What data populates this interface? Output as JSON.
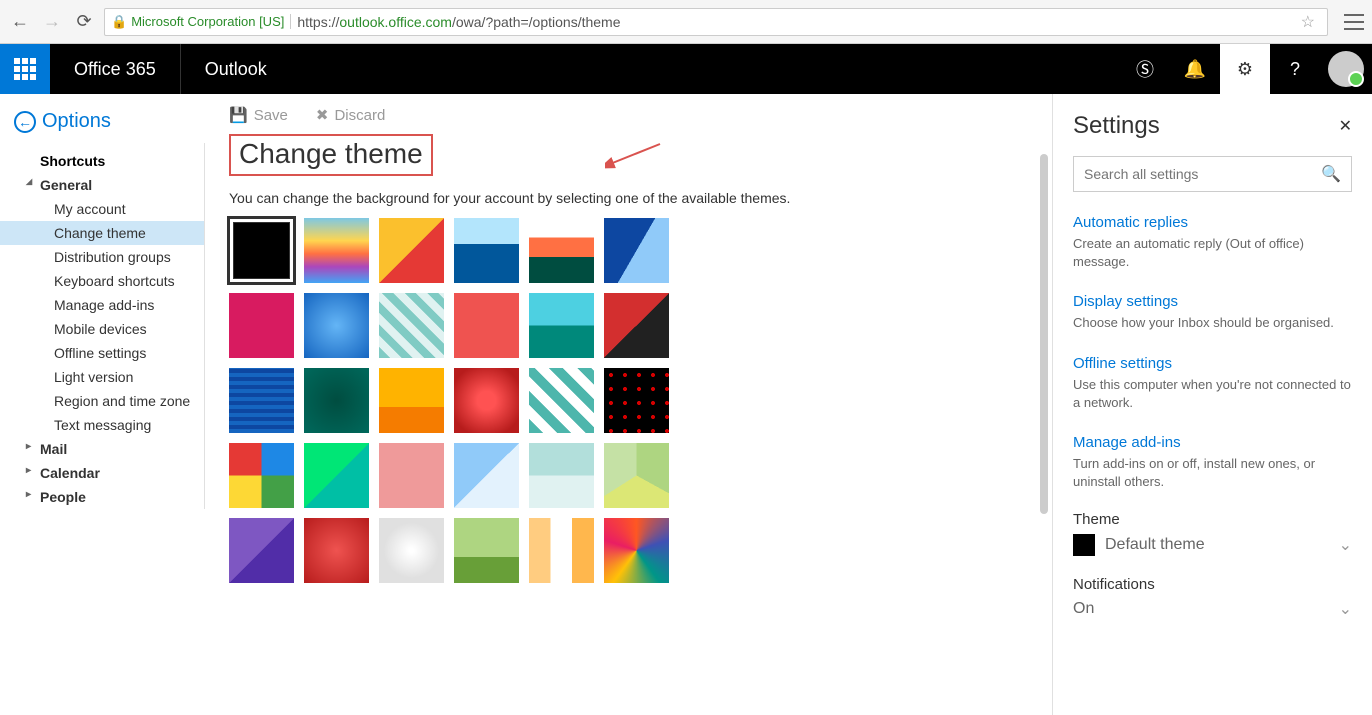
{
  "browser": {
    "verified_org": "Microsoft Corporation [US]",
    "url_domain": "https://",
    "url_host": "outlook.office.com",
    "url_path": "/owa/?path=/options/theme"
  },
  "header": {
    "brand": "Office 365",
    "app": "Outlook"
  },
  "options_link": "Options",
  "sidebar": {
    "shortcuts": "Shortcuts",
    "general": "General",
    "general_items": [
      "My account",
      "Change theme",
      "Distribution groups",
      "Keyboard shortcuts",
      "Manage add-ins",
      "Mobile devices",
      "Offline settings",
      "Light version",
      "Region and time zone",
      "Text messaging"
    ],
    "mail": "Mail",
    "calendar": "Calendar",
    "people": "People"
  },
  "toolbar": {
    "save": "Save",
    "discard": "Discard"
  },
  "page": {
    "title": "Change theme",
    "desc": "You can change the background for your account by selecting one of the available themes."
  },
  "themes": [
    {
      "bg": "#000000",
      "selected": true
    },
    {
      "bg": "linear-gradient(180deg,#7ec8e3 0%,#ffd54f 35%,#ff7043 55%,#ab47bc 75%,#42a5f5 100%)"
    },
    {
      "bg": "linear-gradient(135deg,#fbc02d 50%,#e53935 50%)"
    },
    {
      "bg": "linear-gradient(180deg,#b3e5fc 40%,#01579b 40%)"
    },
    {
      "bg": "linear-gradient(180deg,#fff 30%,#ff7043 30%,#ff7043 60%,#004d40 60%)"
    },
    {
      "bg": "linear-gradient(120deg,#0d47a1 50%,#90caf9 50%)"
    },
    {
      "bg": "#d81b60"
    },
    {
      "bg": "radial-gradient(circle,#64b5f6,#1565c0)"
    },
    {
      "bg": "repeating-linear-gradient(45deg,#80cbc4 0 8px,#e0f2f1 8px 16px)"
    },
    {
      "bg": "#ef5350"
    },
    {
      "bg": "linear-gradient(180deg,#4dd0e1 50%,#00897b 50%)"
    },
    {
      "bg": "linear-gradient(135deg,#d32f2f 50%,#212121 50%)"
    },
    {
      "bg": "repeating-linear-gradient(0deg,#1565c0 0 4px,#0d47a1 4px 8px)"
    },
    {
      "bg": "radial-gradient(circle,#004d40,#00695c)"
    },
    {
      "bg": "linear-gradient(180deg,#ffb300 60%,#f57c00 60%)"
    },
    {
      "bg": "radial-gradient(circle,#ff5252 20%,#b71c1c 80%)"
    },
    {
      "bg": "repeating-linear-gradient(45deg,#4db6ac 0 10px,#fff 10px 20px)"
    },
    {
      "bg": "radial-gradient(#d50000 20%,#000 22%),#000",
      "bgsize": "14px 14px"
    },
    {
      "bg": "conic-gradient(#1e88e5 0 25%,#43a047 25% 50%,#fdd835 50% 75%,#e53935 75%)"
    },
    {
      "bg": "linear-gradient(135deg,#00e676 50%,#00bfa5 50%)"
    },
    {
      "bg": "#ef9a9a"
    },
    {
      "bg": "linear-gradient(135deg,#90caf9 50%,#e3f2fd 50%)"
    },
    {
      "bg": "linear-gradient(180deg,#b2dfdb 50%,#e0f2f1 50%)"
    },
    {
      "bg": "conic-gradient(#aed581 0 33%,#dce775 33% 66%,#c5e1a5 66%)"
    },
    {
      "bg": "linear-gradient(135deg,#7e57c2 50%,#512da8 50%)"
    },
    {
      "bg": "radial-gradient(circle,#ef5350,#b71c1c)"
    },
    {
      "bg": "radial-gradient(circle,#fff 5%,#e0e0e0 60%)"
    },
    {
      "bg": "linear-gradient(180deg,#aed581 60%,#689f38 60%)"
    },
    {
      "bg": "linear-gradient(90deg,#ffcc80 33%,#fff 33% 66%,#ffb74d 66%)"
    },
    {
      "bg": "conic-gradient(#ff5722,#3f51b5,#009688,#ffc107,#e91e63,#ff5722)"
    }
  ],
  "settings": {
    "title": "Settings",
    "search_placeholder": "Search all settings",
    "blocks": [
      {
        "link": "Automatic replies",
        "sub": "Create an automatic reply (Out of office) message."
      },
      {
        "link": "Display settings",
        "sub": "Choose how your Inbox should be organised."
      },
      {
        "link": "Offline settings",
        "sub": "Use this computer when you're not connected to a network."
      },
      {
        "link": "Manage add-ins",
        "sub": "Turn add-ins on or off, install new ones, or uninstall others."
      }
    ],
    "theme_label": "Theme",
    "theme_value": "Default theme",
    "notif_label": "Notifications",
    "notif_value": "On"
  }
}
